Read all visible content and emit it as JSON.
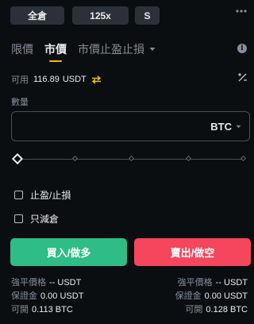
{
  "top_bar": {
    "margin_mode": "全倉",
    "leverage": "125x",
    "position_side": "S"
  },
  "order_tabs": [
    {
      "label": "限價",
      "active": false
    },
    {
      "label": "市價",
      "active": true
    },
    {
      "label": "市價止盈止損",
      "active": false,
      "has_dropdown": true
    }
  ],
  "available": {
    "label": "可用",
    "value": "116.89",
    "unit": "USDT"
  },
  "quantity": {
    "label": "數量",
    "value": "",
    "unit": "BTC"
  },
  "slider": {
    "percent": 0,
    "tick_count": 5
  },
  "options": {
    "tp_sl_label": "止盈/止損",
    "reduce_only_label": "只減倉"
  },
  "buttons": {
    "buy_label": "買入/做多",
    "sell_label": "賣出/做空"
  },
  "buy_info": {
    "liq_label": "強平價格",
    "liq_value": "-- USDT",
    "margin_label": "保證金",
    "margin_value": "0.00 USDT",
    "max_label": "可開",
    "max_value": "0.113 BTC"
  },
  "sell_info": {
    "liq_label": "強平價格",
    "liq_value": "-- USDT",
    "margin_label": "保證金",
    "margin_value": "0.00 USDT",
    "max_label": "可開",
    "max_value": "0.128 BTC"
  },
  "colors": {
    "background": "#0b0e11",
    "accent": "#f0b90b",
    "buy": "#2ebd85",
    "sell": "#f6465d"
  }
}
